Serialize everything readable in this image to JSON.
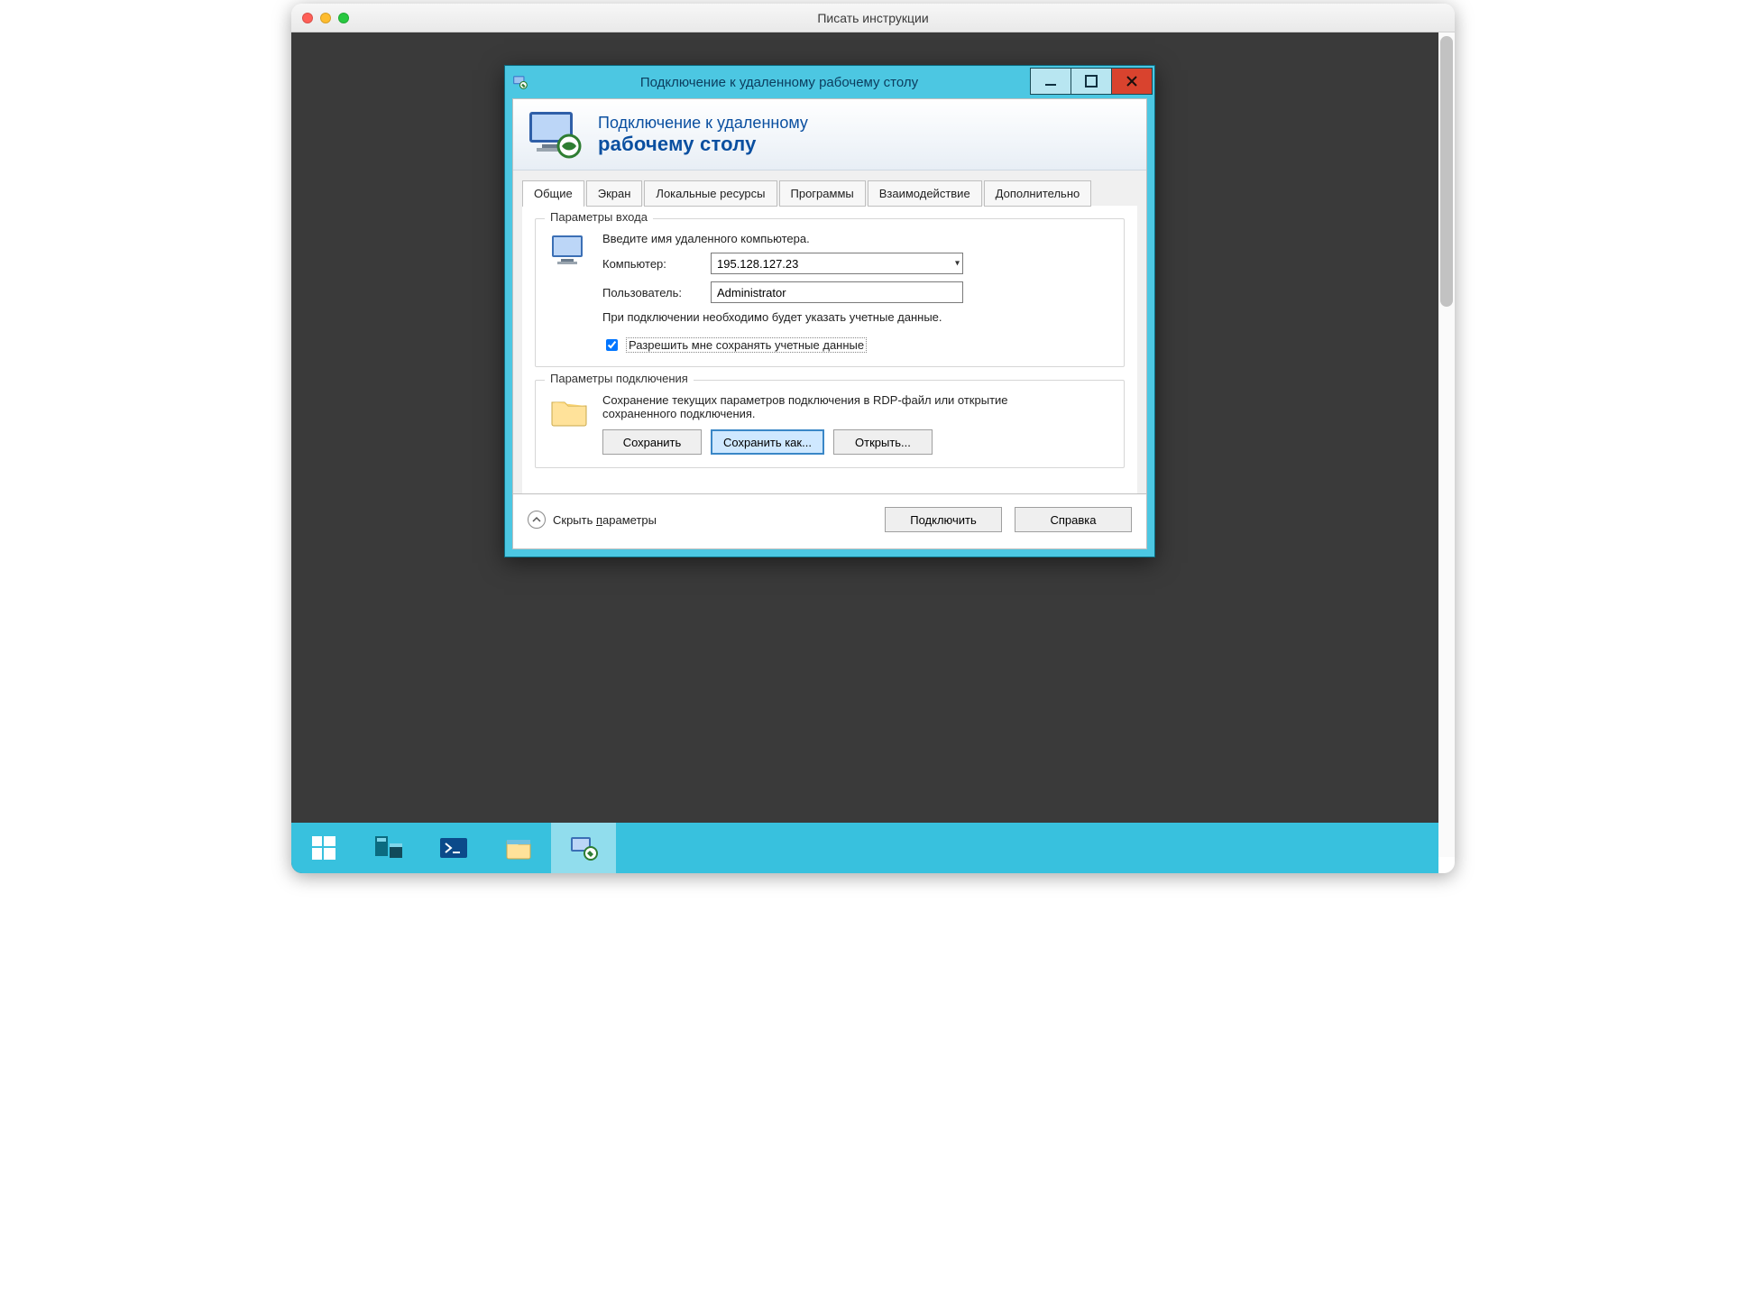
{
  "mac": {
    "title": "Писать инструкции"
  },
  "rdp": {
    "window_title": "Подключение к удаленному рабочему столу",
    "header_line1": "Подключение к удаленному",
    "header_line2": "рабочему столу",
    "tabs": [
      "Общие",
      "Экран",
      "Локальные ресурсы",
      "Программы",
      "Взаимодействие",
      "Дополнительно"
    ],
    "active_tab": 0,
    "login_group": {
      "legend": "Параметры входа",
      "instruction": "Введите имя удаленного компьютера.",
      "computer_label": "Компьютер:",
      "computer_value": "195.128.127.23",
      "user_label": "Пользователь:",
      "user_value": "Administrator",
      "credentials_hint": "При подключении необходимо будет указать учетные данные.",
      "allow_save_label": "Разрешить мне сохранять учетные данные",
      "allow_save_checked": true
    },
    "conn_group": {
      "legend": "Параметры подключения",
      "description": "Сохранение текущих параметров подключения в RDP-файл или открытие сохраненного подключения.",
      "save_btn": "Сохранить",
      "save_as_btn": "Сохранить как...",
      "open_btn": "Открыть..."
    },
    "hide_params_prefix": "Скрыть ",
    "hide_params_letter": "п",
    "hide_params_suffix": "араметры",
    "connect_btn": "Подключить",
    "help_btn": "Справка"
  }
}
